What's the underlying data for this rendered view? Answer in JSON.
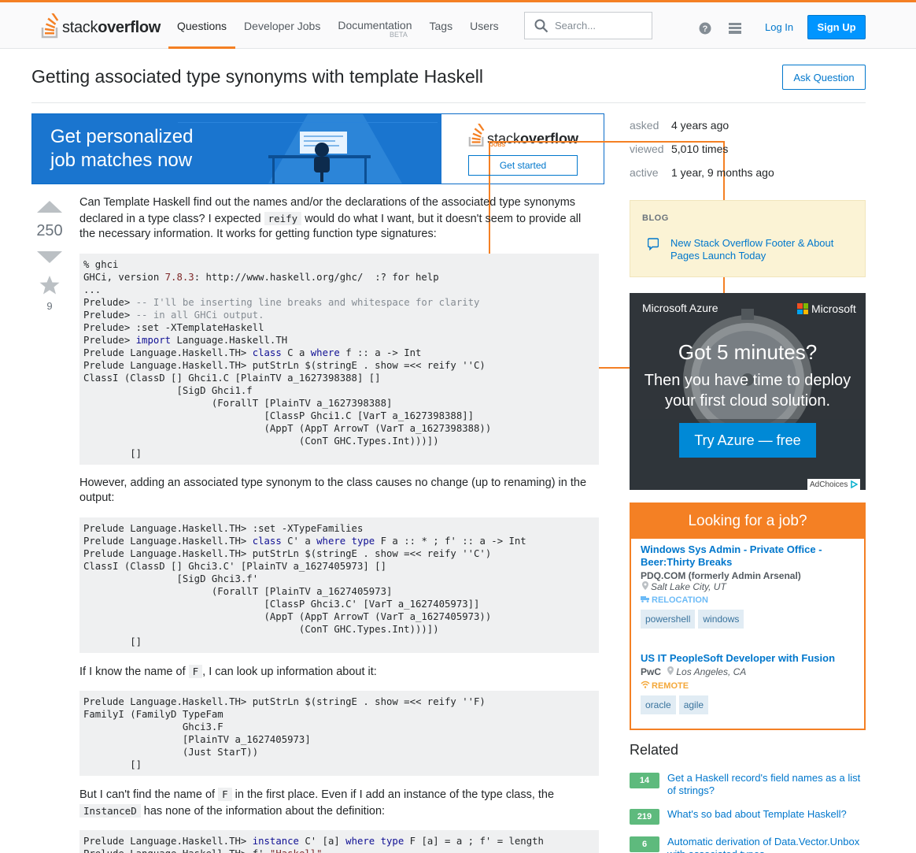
{
  "colors": {
    "accent": "#f48024",
    "link": "#0077cc",
    "primary_button": "#0095ff",
    "answered_green": "#5eba7d"
  },
  "header": {
    "logo_plain": "stack",
    "logo_bold": "overflow",
    "nav": [
      {
        "label": "Questions",
        "active": true
      },
      {
        "label": "Developer Jobs"
      },
      {
        "label": "Documentation",
        "badge": "BETA"
      },
      {
        "label": "Tags"
      },
      {
        "label": "Users"
      }
    ],
    "search_placeholder": "Search...",
    "login": "Log In",
    "signup": "Sign Up"
  },
  "question": {
    "title": "Getting associated type synonyms with template Haskell",
    "ask_button": "Ask Question",
    "votes": "250",
    "favorites": "9"
  },
  "jobs_banner": {
    "line1": "Get personalized",
    "line2": "job matches now",
    "logo_plain": "stack",
    "logo_bold": "overflow",
    "logo_sub": "JOBS",
    "cta": "Get started"
  },
  "post": {
    "p1_a": "Can Template Haskell find out the names and/or the declarations of the associated type synonyms declared in a type class? I expected ",
    "p1_code": "reify",
    "p1_b": " would do what I want, but it doesn't seem to provide all the necessary information. It works for getting function type signatures:",
    "p2": "However, adding an associated type synonym to the class causes no change (up to renaming) in the output:",
    "p3_a": "If I know the name of ",
    "p3_code": "F",
    "p3_b": ", I can look up information about it:",
    "p4_a": "But I can't find the name of ",
    "p4_code": "F",
    "p4_b": " in the first place. Even if I add an instance of the type class, the ",
    "p4_code2": "InstanceD",
    "p4_c": " has none of the information about the definition:"
  },
  "meta": [
    {
      "label": "asked",
      "value": "4 years ago"
    },
    {
      "label": "viewed",
      "value": "5,010 times"
    },
    {
      "label": "active",
      "value": "1 year, 9 months ago"
    }
  ],
  "blog": {
    "heading": "BLOG",
    "link": "New Stack Overflow Footer & About Pages Launch Today"
  },
  "azure_ad": {
    "brand": "Microsoft Azure",
    "ms": "Microsoft",
    "headline": "Got 5 minutes?",
    "sub1": "Then you have time to deploy",
    "sub2": "your first cloud solution.",
    "cta": "Try Azure — free",
    "adchoices": "AdChoices"
  },
  "job_box": {
    "heading": "Looking for a job?",
    "jobs": [
      {
        "title": "Windows Sys Admin - Private Office - Beer:Thirty Breaks",
        "company": "PDQ.COM (formerly Admin Arsenal)",
        "location": "Salt Lake City, UT",
        "perk": "RELOCATION",
        "tags": [
          "powershell",
          "windows"
        ]
      },
      {
        "title": "US IT PeopleSoft Developer with Fusion",
        "company": "PwC",
        "location": "Los Angeles, CA",
        "perk": "REMOTE",
        "tags": [
          "oracle",
          "agile"
        ]
      }
    ]
  },
  "related": {
    "heading": "Related",
    "items": [
      {
        "score": "14",
        "title": "Get a Haskell record's field names as a list of strings?"
      },
      {
        "score": "219",
        "title": "What's so bad about Template Haskell?"
      },
      {
        "score": "6",
        "title": "Automatic derivation of Data.Vector.Unbox with associated types"
      }
    ]
  }
}
